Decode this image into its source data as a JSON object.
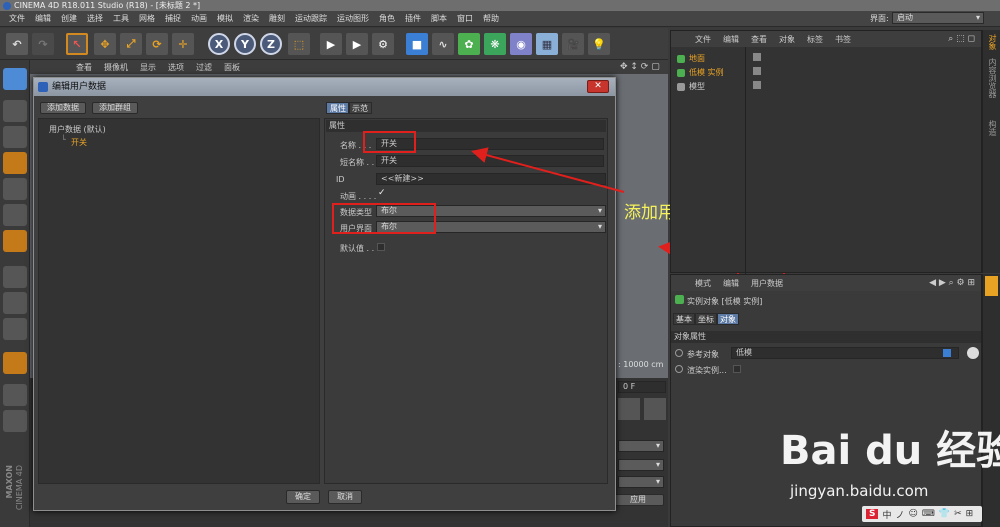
{
  "window": {
    "title": "CINEMA 4D R18.011 Studio (R18) - [未标题 2 *]"
  },
  "menu": [
    "文件",
    "编辑",
    "创建",
    "选择",
    "工具",
    "网格",
    "捕捉",
    "动画",
    "模拟",
    "渲染",
    "雕刻",
    "运动跟踪",
    "运动图形",
    "角色",
    "插件",
    "脚本",
    "窗口",
    "帮助"
  ],
  "layout": {
    "label": "界面:",
    "value": "启动"
  },
  "toolbar": {
    "x": "X",
    "y": "Y",
    "z": "Z"
  },
  "viewport": {
    "menu": [
      "查看",
      "摄像机",
      "显示",
      "选项",
      "过滤",
      "面板"
    ],
    "scale": ": 10000 cm",
    "frame": "0 F",
    "apply": "应用"
  },
  "dialog": {
    "title": "编辑用户数据",
    "close": "✕",
    "add_data": "添加数据",
    "add_group": "添加群组",
    "tree_root": "用户数据 (默认)",
    "tree_child": "开关",
    "tab_attr": "属性",
    "tab_demo": "示范",
    "section": "属性",
    "name_label": "名称 . . .",
    "name_value": "开关",
    "short_label": "短名称 . .",
    "short_value": "开关",
    "id_label": "ID",
    "id_value": "<<新建>>",
    "anim_label": "动画 . . . .",
    "anim_check": "✓",
    "type_label": "数据类型",
    "type_value": "布尔",
    "ui_label": "用户界面",
    "ui_value": "布尔",
    "default_label": "默认值 . .",
    "ok": "确定",
    "cancel": "取消"
  },
  "object_manager": {
    "menu": [
      "文件",
      "编辑",
      "查看",
      "对象",
      "标签",
      "书签"
    ],
    "objects": [
      {
        "name": "地面",
        "color": "#e8a325"
      },
      {
        "name": "低模 实例",
        "color": "#e8a325"
      },
      {
        "name": "模型",
        "color": "#cccccc"
      }
    ]
  },
  "attribute_manager": {
    "menu": [
      "模式",
      "编辑",
      "用户数据"
    ],
    "header": "实例对象 [低模 实例]",
    "tabs": [
      "基本",
      "坐标",
      "对象"
    ],
    "section": "对象属性",
    "ref_label": "参考对象",
    "ref_value": "低模",
    "render_label": "渲染实例..."
  },
  "side_tabs": [
    "对象",
    "内容浏览器",
    "构造"
  ],
  "annotation": {
    "text": "添加用户数据"
  },
  "watermark": {
    "brand": "Bai du 经验",
    "url": "jingyan.baidu.com"
  },
  "taskbar": {
    "items": [
      "S",
      "中",
      "ノ",
      "☺",
      "⌨",
      "👕",
      "✂",
      "⊞"
    ]
  },
  "logo": {
    "line1": "MAXON",
    "line2": "CINEMA 4D"
  }
}
